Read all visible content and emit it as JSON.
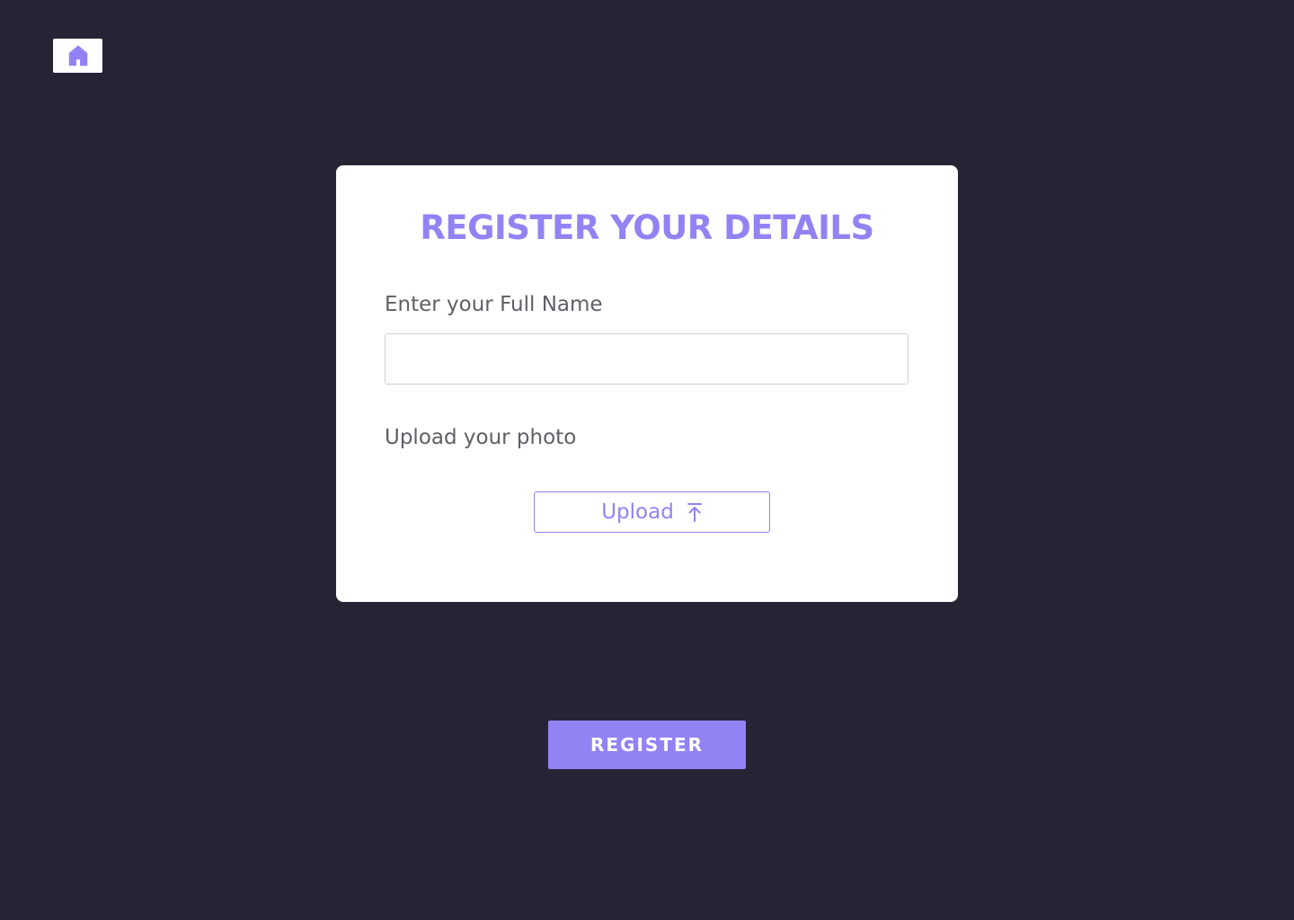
{
  "nav": {
    "home_icon": "home-icon"
  },
  "form": {
    "title": "REGISTER YOUR DETAILS",
    "name_label": "Enter your Full Name",
    "name_value": "",
    "name_placeholder": "",
    "photo_label": "Upload your photo",
    "upload_label": "Upload",
    "upload_icon": "upload-arrow-icon",
    "submit_label": "REGISTER"
  },
  "colors": {
    "background": "#262335",
    "accent": "#9283f5",
    "card": "#ffffff",
    "label_text": "#5f5f66"
  }
}
